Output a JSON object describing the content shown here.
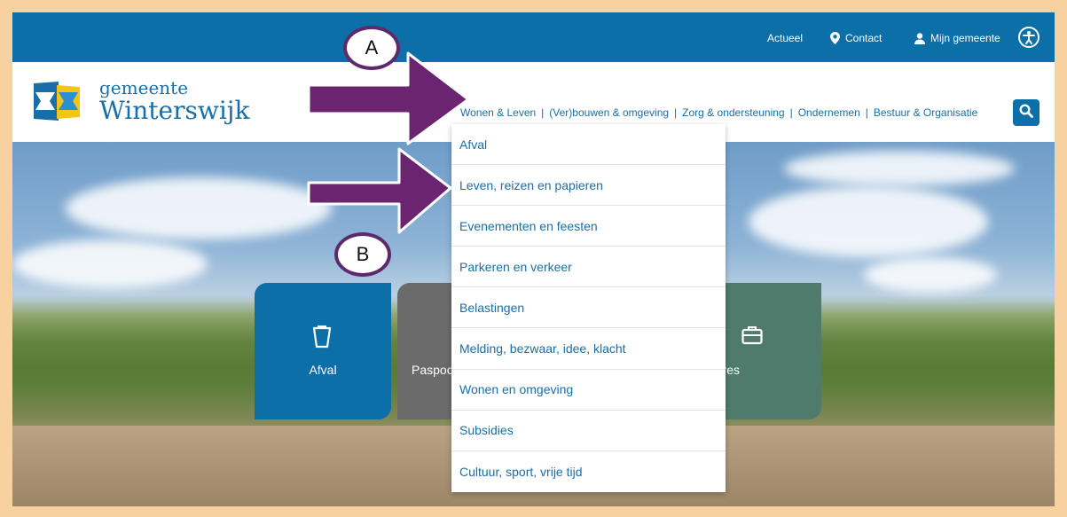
{
  "topbar": {
    "links": [
      {
        "label": "Actueel"
      },
      {
        "label": "Contact"
      },
      {
        "label": "Mijn gemeente"
      }
    ]
  },
  "logo": {
    "line1": "gemeente",
    "line2": "Winterswijk"
  },
  "mainnav": {
    "items": [
      {
        "label": "Wonen & Leven"
      },
      {
        "label": "(Ver)bouwen & omgeving"
      },
      {
        "label": "Zorg & ondersteuning"
      },
      {
        "label": "Ondernemen"
      },
      {
        "label": "Bestuur & Organisatie"
      }
    ],
    "separator": "|"
  },
  "dropdown": {
    "items": [
      {
        "label": "Afval"
      },
      {
        "label": "Leven, reizen en papieren"
      },
      {
        "label": "Evenementen en feesten"
      },
      {
        "label": "Parkeren en verkeer"
      },
      {
        "label": "Belastingen"
      },
      {
        "label": "Melding, bezwaar, idee, klacht"
      },
      {
        "label": "Wonen en omgeving"
      },
      {
        "label": "Subsidies"
      },
      {
        "label": "Cultuur, sport, vrije tijd"
      }
    ]
  },
  "tiles": [
    {
      "label": "Afval",
      "icon": "bin-icon"
    },
    {
      "label": "Paspoo",
      "icon": ""
    },
    {
      "label": "Vacatures",
      "icon": "briefcase-icon"
    }
  ],
  "annotations": {
    "a": "A",
    "b": "B"
  },
  "colors": {
    "brand_blue": "#0d6fa8",
    "link_blue": "#1a6ea7",
    "annotation_purple": "#6b2470",
    "frame": "#f5d2a0"
  }
}
